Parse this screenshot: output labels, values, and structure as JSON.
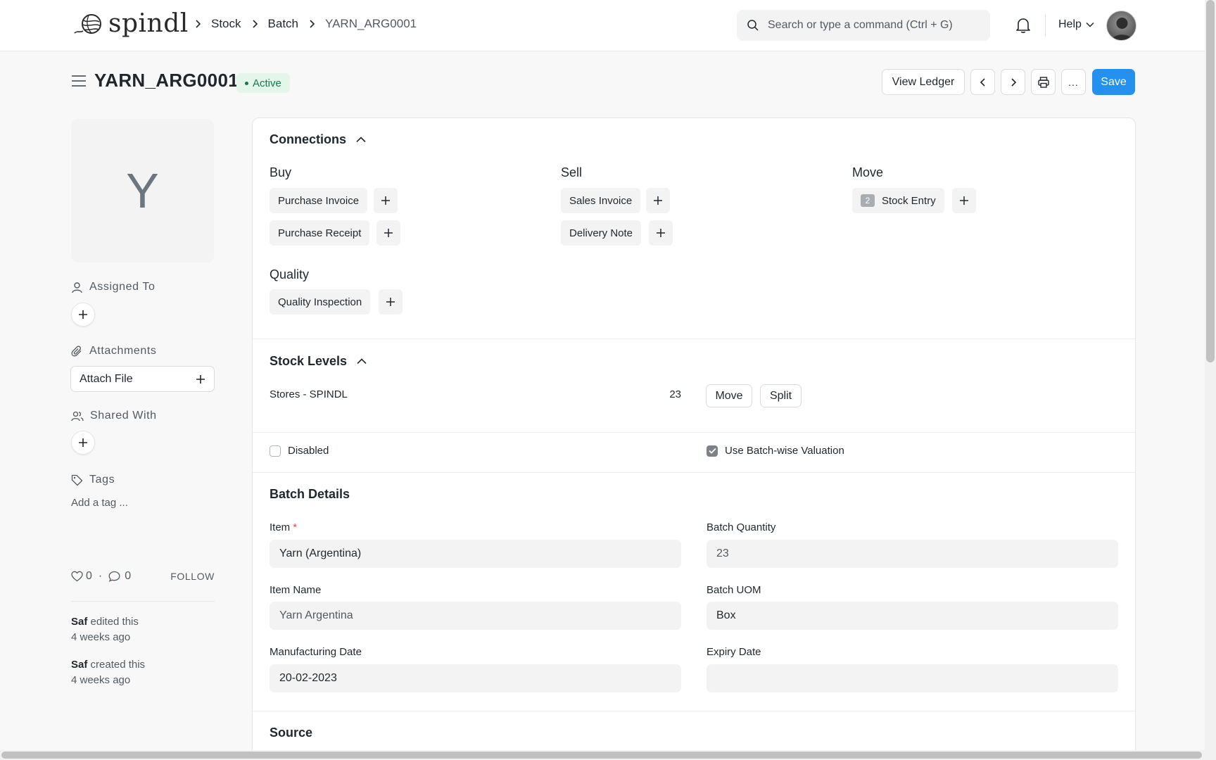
{
  "navbar": {
    "brand": "spindl",
    "breadcrumbs": [
      "Stock",
      "Batch",
      "YARN_ARG0001"
    ],
    "search_placeholder": "Search or type a command (Ctrl + G)",
    "help_label": "Help"
  },
  "page": {
    "title": "YARN_ARG0001",
    "status": "Active",
    "status_color": "#16794c",
    "accent_color": "#2490ef",
    "actions": {
      "view_ledger": "View Ledger",
      "more": "...",
      "save": "Save"
    }
  },
  "sidebar": {
    "image_initial": "Y",
    "assigned_to_label": "Assigned To",
    "attachments_label": "Attachments",
    "attach_file_label": "Attach File",
    "shared_with_label": "Shared With",
    "tags_label": "Tags",
    "add_tag_label": "Add a tag ...",
    "likes": "0",
    "comments": "0",
    "separator": "·",
    "follow_label": "FOLLOW",
    "activity": [
      {
        "user": "Saf",
        "action": " edited this",
        "time": "4 weeks ago"
      },
      {
        "user": "Saf",
        "action": " created this",
        "time": "4 weeks ago"
      }
    ]
  },
  "connections": {
    "title": "Connections",
    "groups": {
      "buy": {
        "label": "Buy",
        "items": [
          "Purchase Invoice",
          "Purchase Receipt"
        ]
      },
      "sell": {
        "label": "Sell",
        "items": [
          "Sales Invoice",
          "Delivery Note"
        ]
      },
      "move": {
        "label": "Move",
        "items": [
          {
            "label": "Stock Entry",
            "count": "2"
          }
        ]
      },
      "quality": {
        "label": "Quality",
        "items": [
          "Quality Inspection"
        ]
      }
    }
  },
  "stock_levels": {
    "title": "Stock Levels",
    "rows": [
      {
        "warehouse": "Stores - SPINDL",
        "qty": "23"
      }
    ],
    "move_label": "Move",
    "split_label": "Split"
  },
  "flags": {
    "disabled": {
      "label": "Disabled",
      "checked": false
    },
    "batch_wise_valuation": {
      "label": "Use Batch-wise Valuation",
      "checked": true
    }
  },
  "batch_details": {
    "title": "Batch Details",
    "item": {
      "label": "Item",
      "required": "*",
      "value": "Yarn (Argentina)"
    },
    "batch_quantity": {
      "label": "Batch Quantity",
      "value": "23"
    },
    "item_name": {
      "label": "Item Name",
      "value": "Yarn Argentina"
    },
    "batch_uom": {
      "label": "Batch UOM",
      "value": "Box"
    },
    "manufacturing_date": {
      "label": "Manufacturing Date",
      "value": "20-02-2023"
    },
    "expiry_date": {
      "label": "Expiry Date",
      "value": ""
    }
  },
  "source": {
    "title": "Source"
  }
}
